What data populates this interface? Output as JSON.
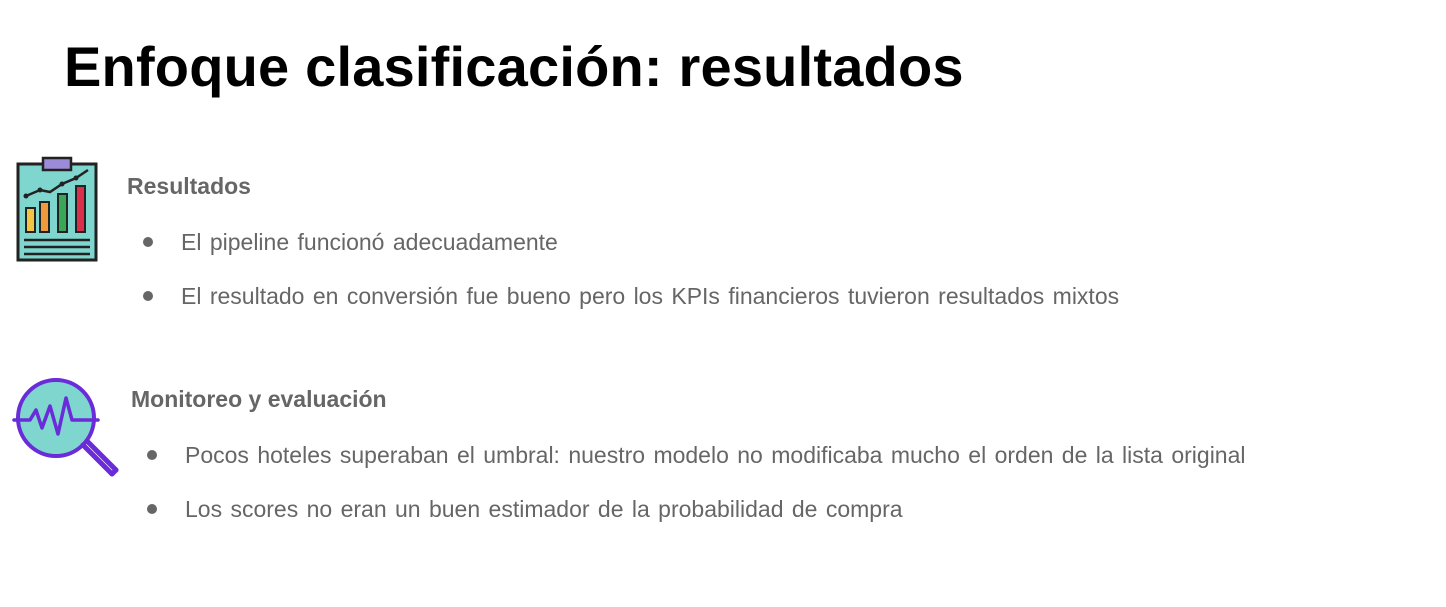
{
  "slide": {
    "title": "Enfoque clasificación: resultados"
  },
  "sections": [
    {
      "icon": "report-chart-icon",
      "heading": "Resultados",
      "bullets": [
        "El pipeline funcionó adecuadamente",
        "El resultado en conversión fue bueno pero los KPIs financieros tuvieron resultados mixtos"
      ]
    },
    {
      "icon": "magnifier-pulse-icon",
      "heading": "Monitoreo y evaluación",
      "bullets": [
        "Pocos hoteles superaban el umbral: nuestro modelo no modificaba mucho el orden de la lista original",
        "Los scores no eran un buen estimador de la probabilidad de compra"
      ]
    }
  ],
  "colors": {
    "title": "#000000",
    "text": "#666666",
    "icon_teal": "#7fd6cf",
    "icon_purple": "#6a2bd8",
    "icon_outline": "#222222"
  }
}
